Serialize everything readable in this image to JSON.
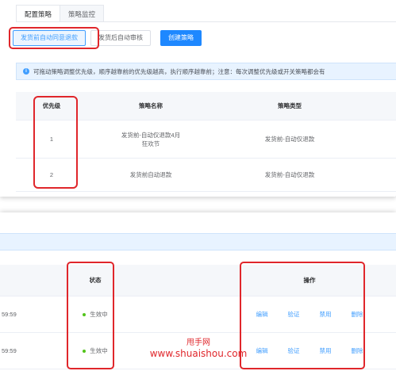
{
  "tabs": [
    {
      "label": "配置策略",
      "active": true
    },
    {
      "label": "策略监控",
      "active": false
    }
  ],
  "actions": {
    "btn1": "发货前自动同意退款",
    "btn2": "发货后自动审核",
    "create": "创建策略"
  },
  "notice": {
    "text": "可拖动策略调整优先级，顺序越靠前的优先级越高，执行顺序越靠前；注意：每次调整优先级或开关策略都会有"
  },
  "table": {
    "headers": {
      "priority": "优先级",
      "name": "策略名称",
      "type": "策略类型"
    },
    "rows": [
      {
        "priority": "1",
        "name": "发货前-自动仅退款4月狂欢节",
        "type": "发货前-自动仅退款"
      },
      {
        "priority": "2",
        "name": "发货前自动退款",
        "type": "发货前-自动仅退款"
      }
    ]
  },
  "bottom": {
    "headers": {
      "status": "状态",
      "ops": "操作"
    },
    "rows": [
      {
        "time": "59:59",
        "status": "生效中"
      },
      {
        "time": "59:59",
        "status": "生效中"
      }
    ],
    "ops": {
      "edit": "编辑",
      "verify": "验证",
      "disable": "禁用",
      "delete": "删除"
    }
  },
  "watermark": {
    "line1": "甩手网",
    "line2": "www.shuaishou.com"
  },
  "colors": {
    "accent": "#409eff",
    "primary": "#1e88ff",
    "highlight": "#e0262b",
    "success": "#52c41a"
  }
}
